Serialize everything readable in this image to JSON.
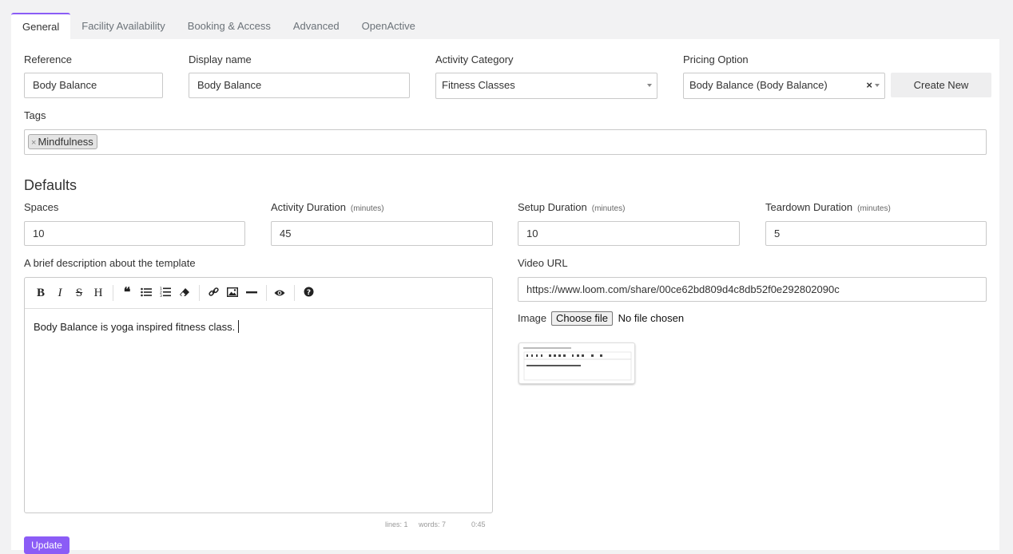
{
  "tabs": [
    {
      "label": "General",
      "active": true
    },
    {
      "label": "Facility Availability"
    },
    {
      "label": "Booking & Access"
    },
    {
      "label": "Advanced"
    },
    {
      "label": "OpenActive"
    }
  ],
  "form": {
    "reference": {
      "label": "Reference",
      "value": "Body Balance"
    },
    "display_name": {
      "label": "Display name",
      "value": "Body Balance"
    },
    "activity_category": {
      "label": "Activity Category",
      "value": "Fitness Classes"
    },
    "pricing_option": {
      "label": "Pricing Option",
      "value": "Body Balance (Body Balance)",
      "clear": "×"
    },
    "create_new": "Create New",
    "tags": {
      "label": "Tags",
      "items": [
        "Mindfulness"
      ],
      "remove": "×"
    }
  },
  "defaults": {
    "heading": "Defaults",
    "spaces": {
      "label": "Spaces",
      "value": "10"
    },
    "activity_duration": {
      "label": "Activity Duration",
      "unit": "(minutes)",
      "value": "45"
    },
    "setup_duration": {
      "label": "Setup Duration",
      "unit": "(minutes)",
      "value": "10"
    },
    "teardown_duration": {
      "label": "Teardown Duration",
      "unit": "(minutes)",
      "value": "5"
    }
  },
  "description": {
    "label": "A brief description about the template",
    "text": "Body Balance is yoga inspired fitness class.",
    "toolbar": [
      "bold-icon",
      "italic-icon",
      "strikethrough-icon",
      "heading-icon",
      "quote-icon",
      "unordered-list-icon",
      "ordered-list-icon",
      "eraser-icon",
      "link-icon",
      "image-icon",
      "horizontal-rule-icon",
      "preview-icon",
      "help-icon"
    ],
    "status": {
      "lines": "lines: 1",
      "words": "words: 7",
      "cursor": "0:45"
    }
  },
  "video": {
    "label": "Video URL",
    "value": "https://www.loom.com/share/00ce62bd809d4c8db52f0e292802090c"
  },
  "image": {
    "label": "Image",
    "button": "Choose file",
    "status": "No file chosen"
  },
  "update_button": "Update",
  "colors": {
    "accent": "#8b5cf6",
    "panel": "#ffffff",
    "background": "#f2f2f3"
  }
}
